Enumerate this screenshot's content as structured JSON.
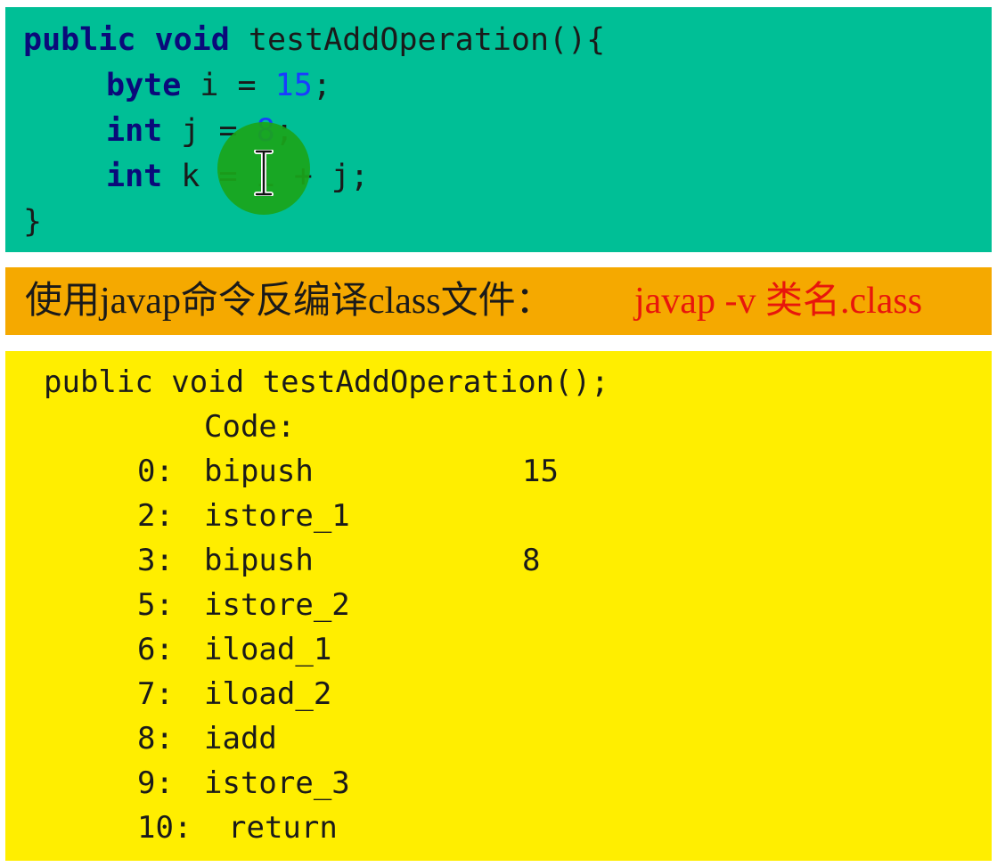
{
  "source_code": {
    "line1": {
      "kw1": "public",
      "kw2": "void",
      "rest": "testAddOperation(){"
    },
    "line2": {
      "type": "byte",
      "decl": "i =",
      "value": "15",
      "end": ";"
    },
    "line3": {
      "type": "int",
      "decl": "j =",
      "value": "8",
      "end": ";"
    },
    "line4": {
      "type": "int",
      "expr": "k = i + j;"
    },
    "line5": "}"
  },
  "banner": {
    "text": "使用javap命令反编译class文件：",
    "command": "javap -v 类名.class"
  },
  "bytecode": {
    "signature": "public void testAddOperation();",
    "code_label": "Code:",
    "instructions": [
      {
        "offset": "0:",
        "op": "bipush",
        "arg": "15"
      },
      {
        "offset": "2:",
        "op": "istore_1",
        "arg": ""
      },
      {
        "offset": "3:",
        "op": "bipush",
        "arg": "8"
      },
      {
        "offset": "5:",
        "op": "istore_2",
        "arg": ""
      },
      {
        "offset": "6:",
        "op": "iload_1",
        "arg": ""
      },
      {
        "offset": "7:",
        "op": "iload_2",
        "arg": ""
      },
      {
        "offset": "8:",
        "op": "iadd",
        "arg": ""
      },
      {
        "offset": "9:",
        "op": "istore_3",
        "arg": ""
      },
      {
        "offset": "10:",
        "op": "return",
        "arg": ""
      }
    ]
  },
  "colors": {
    "code_panel": "#00bf96",
    "banner_panel": "#f5a900",
    "bytecode_panel": "#ffee00",
    "command_text": "#e8160c",
    "cursor_highlight": "#1aa51a"
  }
}
